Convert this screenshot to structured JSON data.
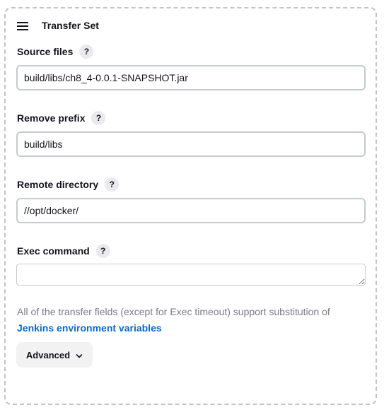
{
  "section": {
    "title": "Transfer Set"
  },
  "fields": {
    "source_files": {
      "label": "Source files",
      "help": "?",
      "value": "build/libs/ch8_4-0.0.1-SNAPSHOT.jar"
    },
    "remove_prefix": {
      "label": "Remove prefix",
      "help": "?",
      "value": "build/libs"
    },
    "remote_directory": {
      "label": "Remote directory",
      "help": "?",
      "value": "//opt/docker/"
    },
    "exec_command": {
      "label": "Exec command",
      "help": "?",
      "value": ""
    }
  },
  "help_text": {
    "text": "All of the transfer fields (except for Exec timeout) support substitution of ",
    "link": "Jenkins environment variables"
  },
  "advanced": {
    "label": "Advanced"
  },
  "icons": {
    "drag": "hamburger-icon",
    "advanced": "chevron-down-icon"
  },
  "colors": {
    "link": "#0b6ac4",
    "muted_text": "#7a7a85",
    "border": "#c6cbd1"
  }
}
